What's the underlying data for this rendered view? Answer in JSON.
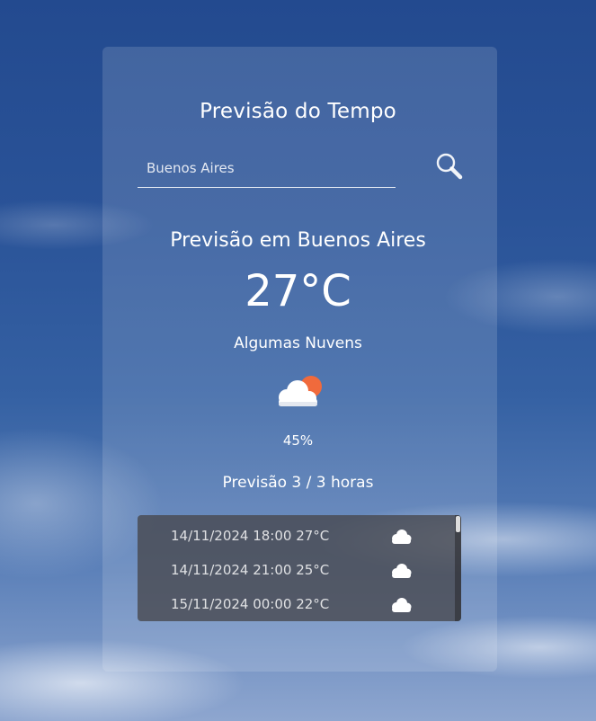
{
  "app": {
    "title": "Previsão do Tempo"
  },
  "search": {
    "placeholder": "Buenos Aires",
    "value": "",
    "button_icon": "search-icon"
  },
  "current": {
    "heading": "Previsão em Buenos Aires",
    "temperature": "27°C",
    "description": "Algumas Nuvens",
    "icon": "partly-cloudy-icon",
    "humidity": "45%"
  },
  "hourly": {
    "title": "Previsão 3 / 3 horas",
    "items": [
      {
        "label": "14/11/2024 18:00 27°C",
        "icon": "cloud-icon"
      },
      {
        "label": "14/11/2024 21:00 25°C",
        "icon": "cloud-icon"
      },
      {
        "label": "15/11/2024 00:00 22°C",
        "icon": "cloud-icon"
      }
    ]
  },
  "colors": {
    "sky_top": "#234a8f",
    "sun": "#f06a3c",
    "cloud": "#ffffff",
    "list_background": "#46464c"
  }
}
